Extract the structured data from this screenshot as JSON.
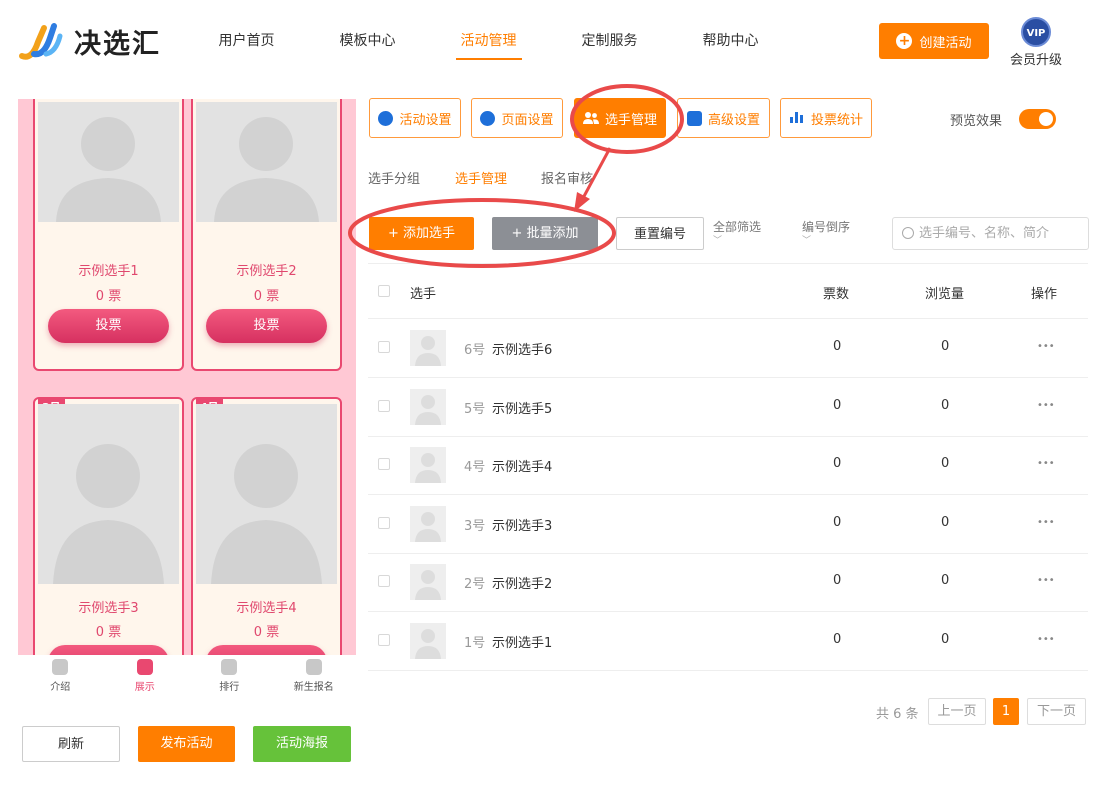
{
  "header": {
    "brand": "决选汇",
    "nav": [
      "用户首页",
      "模板中心",
      "活动管理",
      "定制服务",
      "帮助中心"
    ],
    "create_label": "创建活动",
    "vip_badge": "VIP",
    "vip_label": "会员升级",
    "colors": {
      "accent": "#ff7e00",
      "pink": "#e94870",
      "green": "#66c23a"
    }
  },
  "preview": {
    "cards": [
      {
        "name": "示例选手1",
        "votes": "0 票",
        "vote_label": "投票",
        "tag": ""
      },
      {
        "name": "示例选手2",
        "votes": "0 票",
        "vote_label": "投票",
        "tag": ""
      },
      {
        "name": "示例选手3",
        "votes": "0 票",
        "vote_label": "",
        "tag": "3号"
      },
      {
        "name": "示例选手4",
        "votes": "0 票",
        "vote_label": "",
        "tag": "4号"
      }
    ],
    "bottom_nav": [
      "介绍",
      "展示",
      "排行",
      "新生报名"
    ],
    "refresh_label": "刷新",
    "publish_label": "发布活动",
    "poster_label": "活动海报"
  },
  "tabs": [
    "活动设置",
    "页面设置",
    "选手管理",
    "高级设置",
    "投票统计"
  ],
  "preview_toggle_label": "预览效果",
  "subtabs": [
    "选手分组",
    "选手管理",
    "报名审核"
  ],
  "toolbar": {
    "add_label": "+ 添加选手",
    "batch_label": "+ 批量添加",
    "renumber_label": "重置编号",
    "filter_label": "全部筛选",
    "sort_label": "编号倒序",
    "search_placeholder": "选手编号、名称、简介"
  },
  "table": {
    "headers": [
      "选手",
      "票数",
      "浏览量",
      "操作"
    ],
    "rows": [
      {
        "num": "6号",
        "name": "示例选手6",
        "votes": "0",
        "views": "0",
        "action": "•••"
      },
      {
        "num": "5号",
        "name": "示例选手5",
        "votes": "0",
        "views": "0",
        "action": "•••"
      },
      {
        "num": "4号",
        "name": "示例选手4",
        "votes": "0",
        "views": "0",
        "action": "•••"
      },
      {
        "num": "3号",
        "name": "示例选手3",
        "votes": "0",
        "views": "0",
        "action": "•••"
      },
      {
        "num": "2号",
        "name": "示例选手2",
        "votes": "0",
        "views": "0",
        "action": "•••"
      },
      {
        "num": "1号",
        "name": "示例选手1",
        "votes": "0",
        "views": "0",
        "action": "•••"
      }
    ]
  },
  "pagination": {
    "total": "共 6 条",
    "prev": "上一页",
    "current": "1",
    "next": "下一页"
  }
}
